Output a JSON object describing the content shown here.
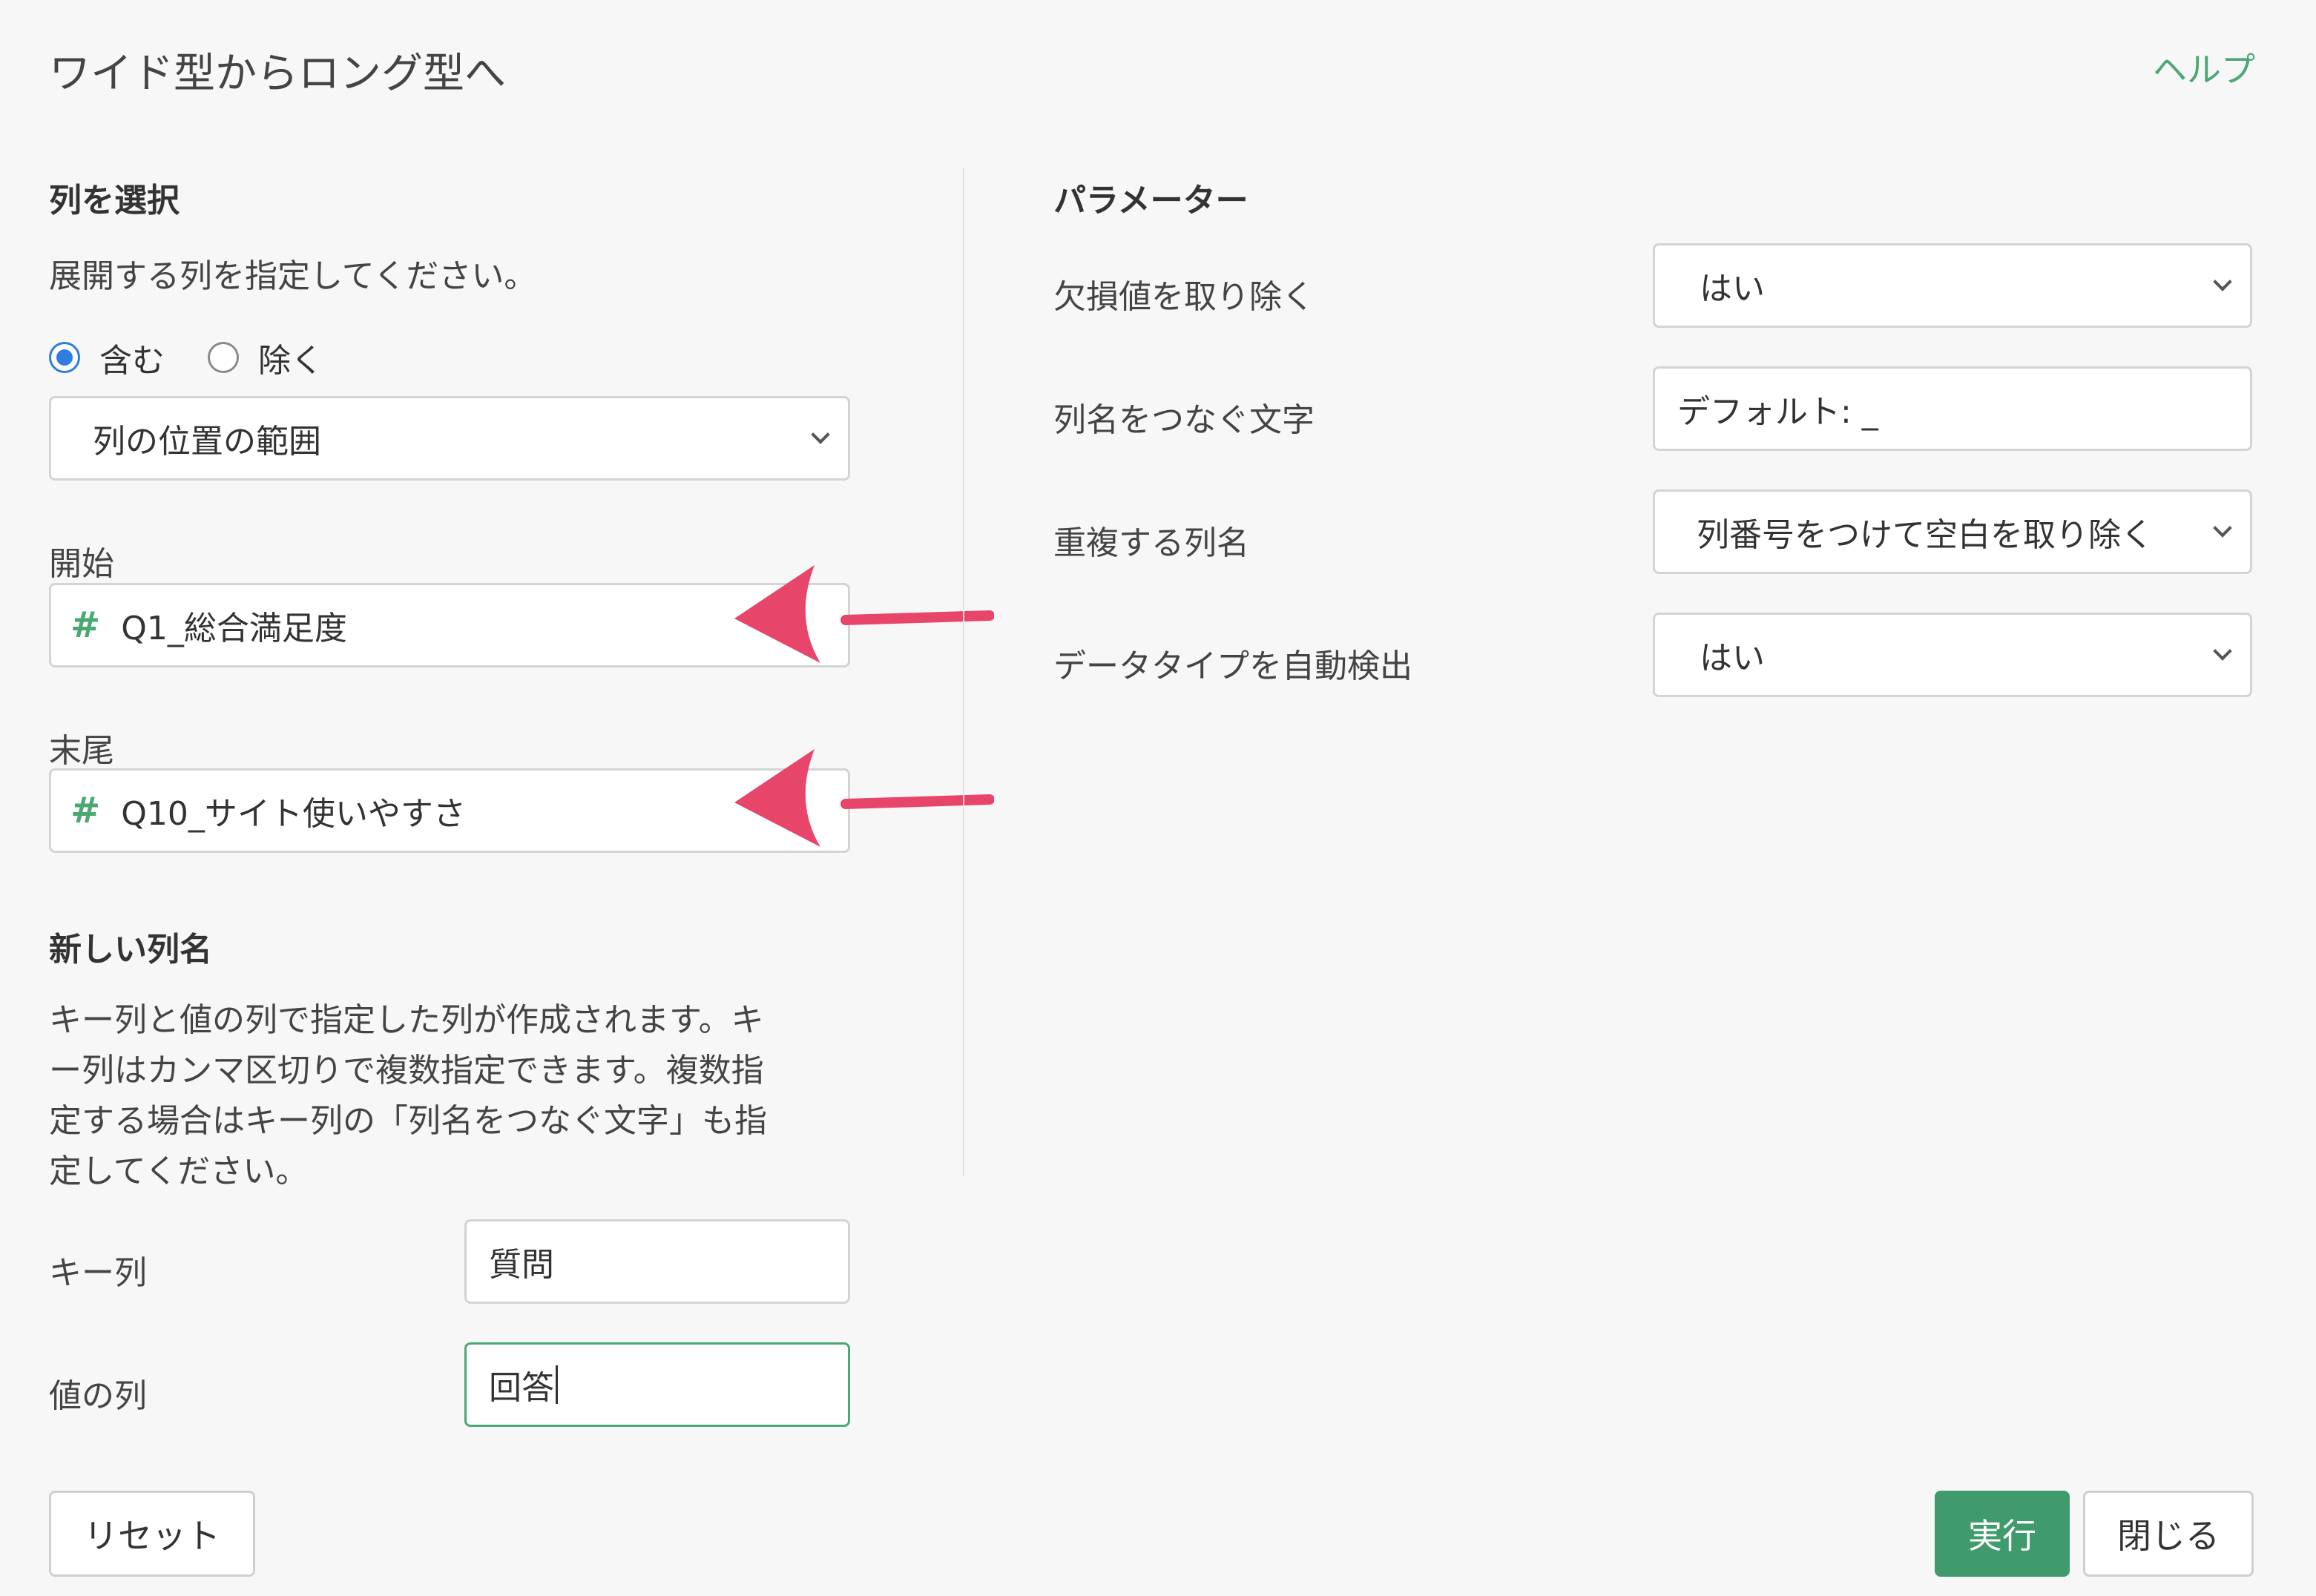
{
  "header": {
    "title": "ワイド型からロング型へ",
    "help_label": "ヘルプ"
  },
  "column_select": {
    "heading": "列を選択",
    "description": "展開する列を指定してください。",
    "mode_include_label": "含む",
    "mode_exclude_label": "除く",
    "mode_selected": "含む",
    "selection_type": "列の位置の範囲",
    "start_label": "開始",
    "start_value": "Q1_総合満足度",
    "end_label": "末尾",
    "end_value": "Q10_サイト使いやすさ",
    "column_type_icon": "number-hash-icon"
  },
  "new_columns": {
    "heading": "新しい列名",
    "description_lines": [
      "キー列と値の列で指定した列が作成されます。キ",
      "ー列はカンマ区切りで複数指定できます。複数指",
      "定する場合はキー列の「列名をつなぐ文字」も指",
      "定してください。"
    ],
    "key_label": "キー列",
    "key_value": "質問",
    "value_label": "値の列",
    "value_value": "回答"
  },
  "parameters": {
    "heading": "パラメーター",
    "remove_na_label": "欠損値を取り除く",
    "remove_na_value": "はい",
    "sep_label": "列名をつなぐ文字",
    "sep_placeholder": "デフォルト: _",
    "dup_label": "重複する列名",
    "dup_value": "列番号をつけて空白を取り除く",
    "detect_type_label": "データタイプを自動検出",
    "detect_type_value": "はい"
  },
  "footer": {
    "reset_label": "リセット",
    "run_label": "実行",
    "close_label": "閉じる"
  },
  "colors": {
    "accent": "#4aa872",
    "primary_button": "#3f9b6b",
    "radio": "#2f7de1",
    "annotation_arrow": "#e8456b"
  }
}
